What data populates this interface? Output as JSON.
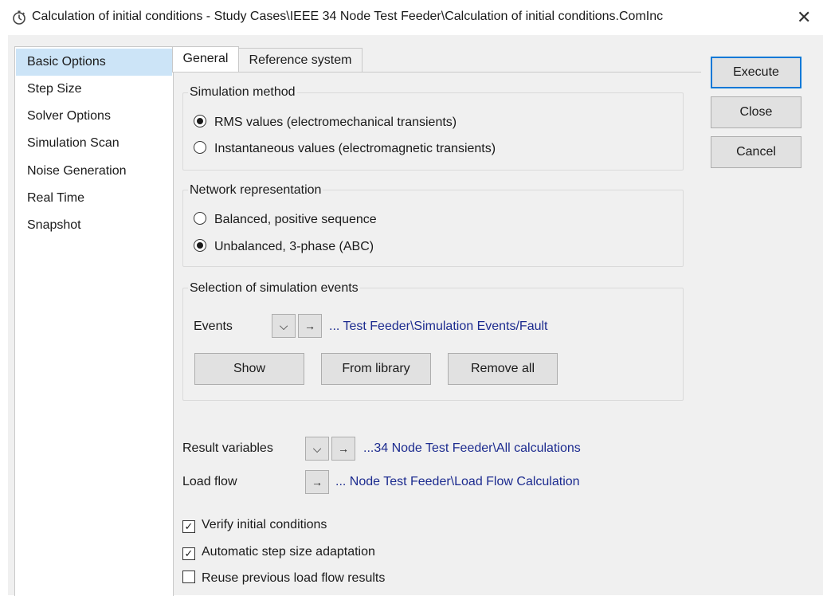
{
  "window": {
    "title": "Calculation of initial conditions - Study Cases\\IEEE 34 Node Test Feeder\\Calculation of initial conditions.ComInc",
    "close_glyph": "✕"
  },
  "sidebar": {
    "items": [
      {
        "label": "Basic Options",
        "selected": true
      },
      {
        "label": "Step Size"
      },
      {
        "label": "Solver Options"
      },
      {
        "label": "Simulation Scan"
      },
      {
        "label": "Noise Generation"
      },
      {
        "label": "Real Time"
      },
      {
        "label": "Snapshot"
      }
    ]
  },
  "tabs": [
    {
      "label": "General",
      "active": true
    },
    {
      "label": "Reference system"
    }
  ],
  "simulation_method": {
    "title": "Simulation method",
    "options": [
      {
        "label": "RMS values (electromechanical transients)",
        "selected": true
      },
      {
        "label": "Instantaneous values (electromagnetic transients)",
        "selected": false
      }
    ]
  },
  "network_representation": {
    "title": "Network representation",
    "options": [
      {
        "label": "Balanced, positive sequence",
        "selected": false
      },
      {
        "label": "Unbalanced, 3-phase (ABC)",
        "selected": true
      }
    ]
  },
  "events": {
    "title": "Selection of simulation events",
    "label": "Events",
    "link": "... Test Feeder\\Simulation Events/Fault",
    "buttons": {
      "show": "Show",
      "from_library": "From library",
      "remove_all": "Remove all"
    }
  },
  "result_variables": {
    "label": "Result variables",
    "link": "...34 Node Test Feeder\\All calculations"
  },
  "load_flow": {
    "label": "Load flow",
    "link": "... Node Test Feeder\\Load Flow Calculation"
  },
  "checkboxes": [
    {
      "label": "Verify initial conditions",
      "checked": true
    },
    {
      "label": "Automatic step size adaptation",
      "checked": true
    },
    {
      "label": "Reuse previous load flow results",
      "checked": false
    }
  ],
  "actions": {
    "execute": "Execute",
    "close": "Close",
    "cancel": "Cancel"
  },
  "glyphs": {
    "dropdown": "⌵",
    "arrow": "→",
    "check": "✓"
  },
  "colors": {
    "selection": "#cce4f7",
    "link": "#1c2b8f",
    "default_button_border": "#0078d7"
  }
}
